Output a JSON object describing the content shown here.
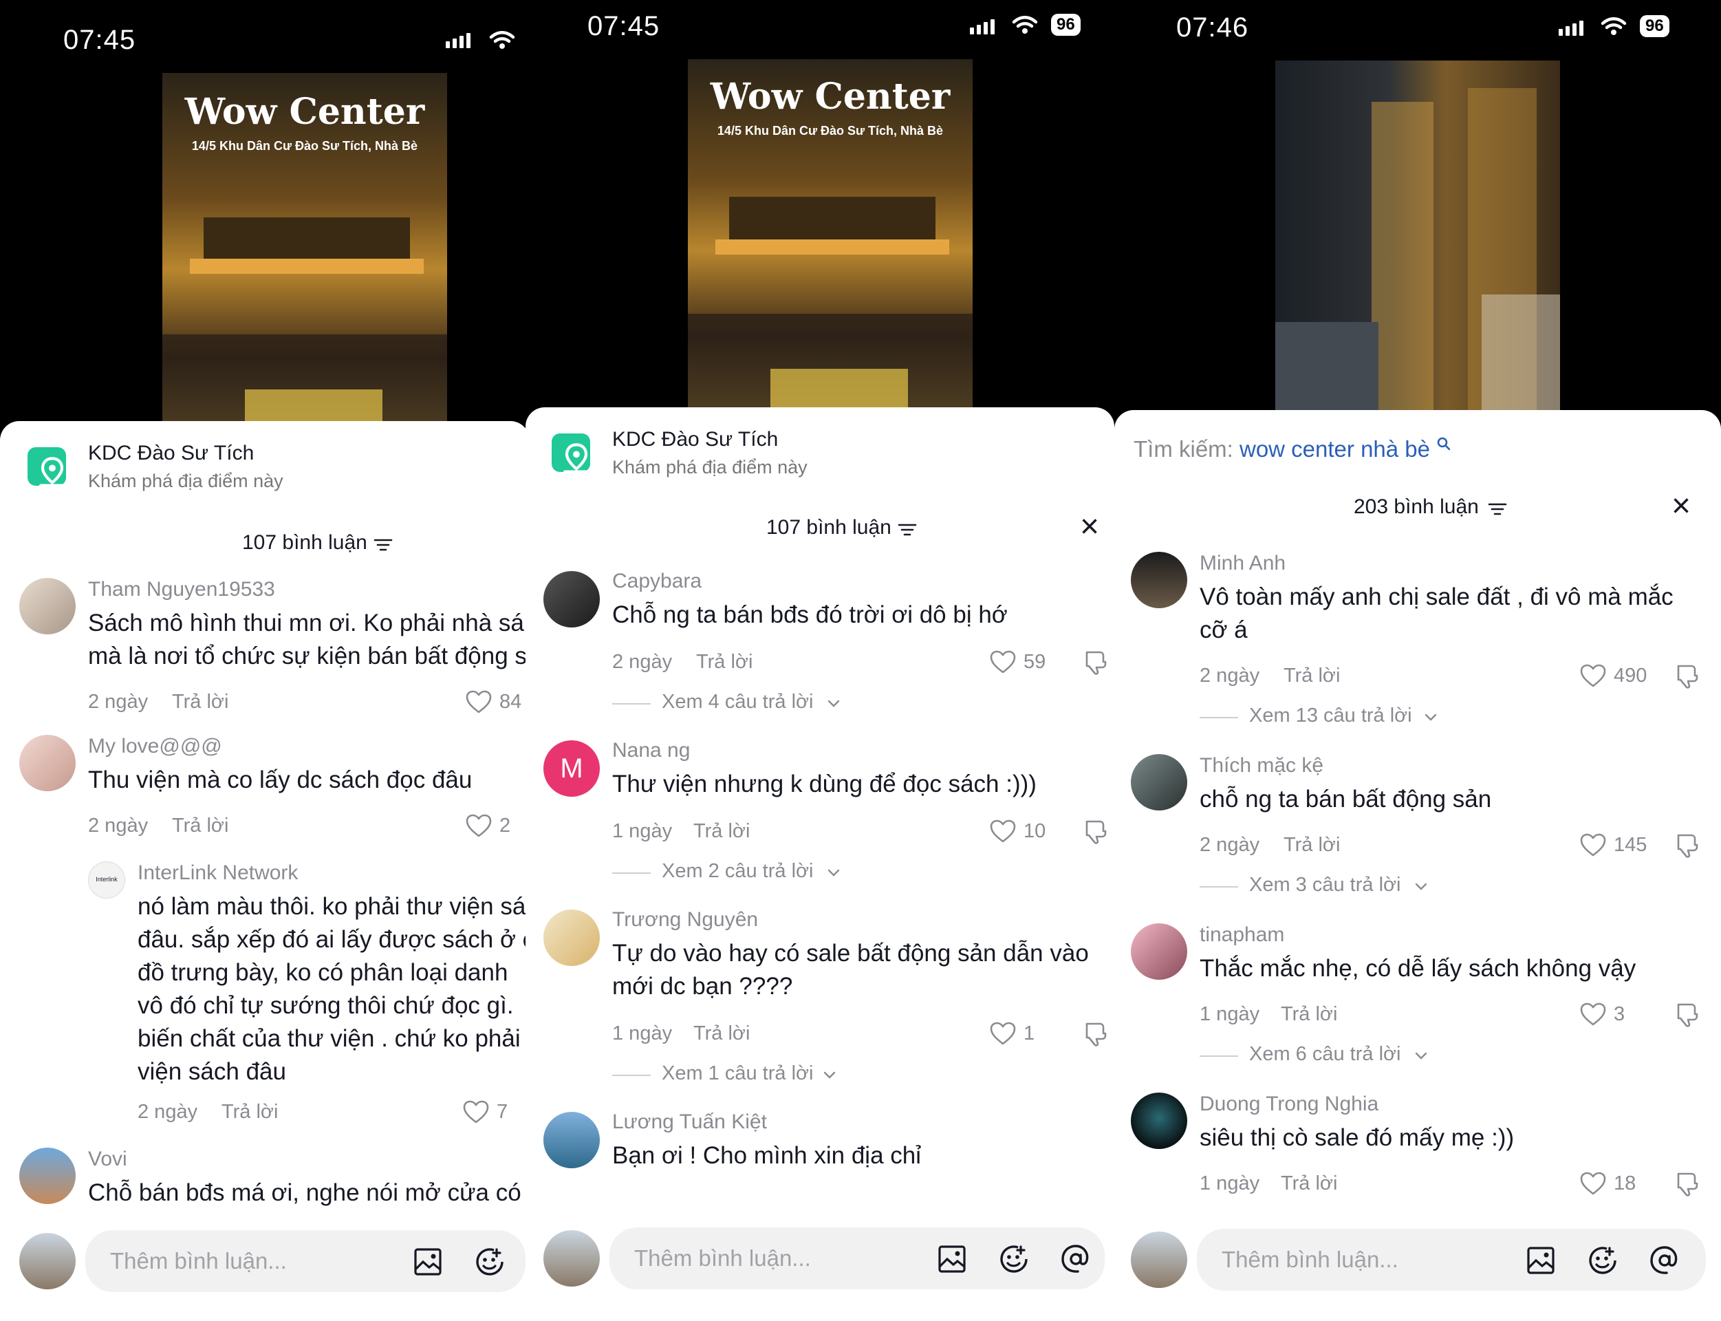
{
  "panel1": {
    "time": "07:45",
    "video": {
      "title": "Wow Center",
      "address": "14/5 Khu Dân Cư Đào Sư Tích, Nhà Bè"
    },
    "location": {
      "title": "KDC Đào Sư Tích",
      "subtitle": "Khám phá địa điểm này"
    },
    "comment_count": "107 bình luận",
    "comments": [
      {
        "user": "Tham Nguyen19533",
        "text": "Sách mô hình thui mn ơi. Ko phải nhà sá\nmà là nơi tổ chức sự kiện bán bất động s",
        "age": "2 ngày",
        "reply": "Trả lời",
        "likes": "84"
      },
      {
        "user": "My love@@@",
        "text": "Thu viện mà co lấy dc sách đọc đâu",
        "age": "2 ngày",
        "reply": "Trả lời",
        "likes": "2"
      },
      {
        "user": "InterLink Network",
        "text": "nó làm màu thôi. ko phải thư viện sá\nđâu. sắp xếp đó ai lấy được sách ở c\nđồ trưng bày, ko có phân loại danh\nvô đó chỉ tự sướng thôi chứ đọc gì.\nbiến chất của thư viện . chứ ko phải\nviện sách đâu",
        "age": "2 ngày",
        "reply": "Trả lời",
        "likes": "7",
        "avatar_label": "Interlink"
      },
      {
        "user": "Vovi",
        "text": "Chỗ bán bđs má ơi, nghe nói mở cửa có"
      }
    ],
    "input_placeholder": "Thêm bình luận..."
  },
  "panel2": {
    "time": "07:45",
    "battery": "96",
    "video": {
      "title": "Wow Center",
      "address": "14/5 Khu Dân Cư Đào Sư Tích, Nhà Bè"
    },
    "location": {
      "title": "KDC Đào Sư Tích",
      "subtitle": "Khám phá địa điểm này"
    },
    "comment_count": "107 bình luận",
    "comments": [
      {
        "user": "Capybara",
        "text": "Chỗ ng ta bán bđs đó trời ơi dô bị hớ",
        "age": "2 ngày",
        "reply": "Trả lời",
        "likes": "59",
        "view": "Xem 4 câu trả lời"
      },
      {
        "user": "Nana ng",
        "text": "Thư viện nhưng k dùng để đọc sách :)))",
        "age": "1 ngày",
        "reply": "Trả lời",
        "likes": "10",
        "view": "Xem 2 câu trả lời",
        "avatar_letter": "M"
      },
      {
        "user": "Trương Nguyên",
        "text": "Tự do vào hay có sale bất động sản dẫn vào\nmới dc bạn ????",
        "age": "1 ngày",
        "reply": "Trả lời",
        "likes": "1",
        "view": "Xem 1 câu trả lời"
      },
      {
        "user": "Lương Tuấn Kiệt",
        "text": "Bạn ơi ! Cho mình xin địa chỉ"
      }
    ],
    "input_placeholder": "Thêm bình luận..."
  },
  "panel3": {
    "time": "07:46",
    "battery": "96",
    "search": {
      "label": "Tìm kiếm:",
      "query": "wow center nhà bè"
    },
    "comment_count": "203 bình luận",
    "comments": [
      {
        "user": "Minh Anh",
        "text": "Vô toàn mấy anh chị sale đất , đi vô mà mắc\ncỡ á",
        "age": "2 ngày",
        "reply": "Trả lời",
        "likes": "490",
        "view": "Xem 13 câu trả lời"
      },
      {
        "user": "Thích mặc kệ",
        "text": "chỗ ng ta bán bất động sản",
        "age": "2 ngày",
        "reply": "Trả lời",
        "likes": "145",
        "view": "Xem 3 câu trả lời"
      },
      {
        "user": "tinapham",
        "text": "Thắc mắc nhẹ, có dễ lấy sách không vậy",
        "age": "1 ngày",
        "reply": "Trả lời",
        "likes": "3",
        "view": "Xem 6 câu trả lời"
      },
      {
        "user": "Duong Trong Nghia",
        "text": "siêu thị cò sale đó mấy mẹ :))",
        "age": "1 ngày",
        "reply": "Trả lời",
        "likes": "18"
      }
    ],
    "input_placeholder": "Thêm bình luận..."
  },
  "colors": {
    "accent_link": "#2b5fb8",
    "location_green": "#20c997",
    "avatar_pink": "#e8356f"
  },
  "icons": [
    "signal-icon",
    "wifi-icon",
    "battery-icon",
    "location-pin-icon",
    "sort-icon",
    "close-icon",
    "heart-icon",
    "dislike-icon",
    "chevron-down-icon",
    "image-icon",
    "emoji-icon",
    "mention-icon",
    "search-icon"
  ]
}
